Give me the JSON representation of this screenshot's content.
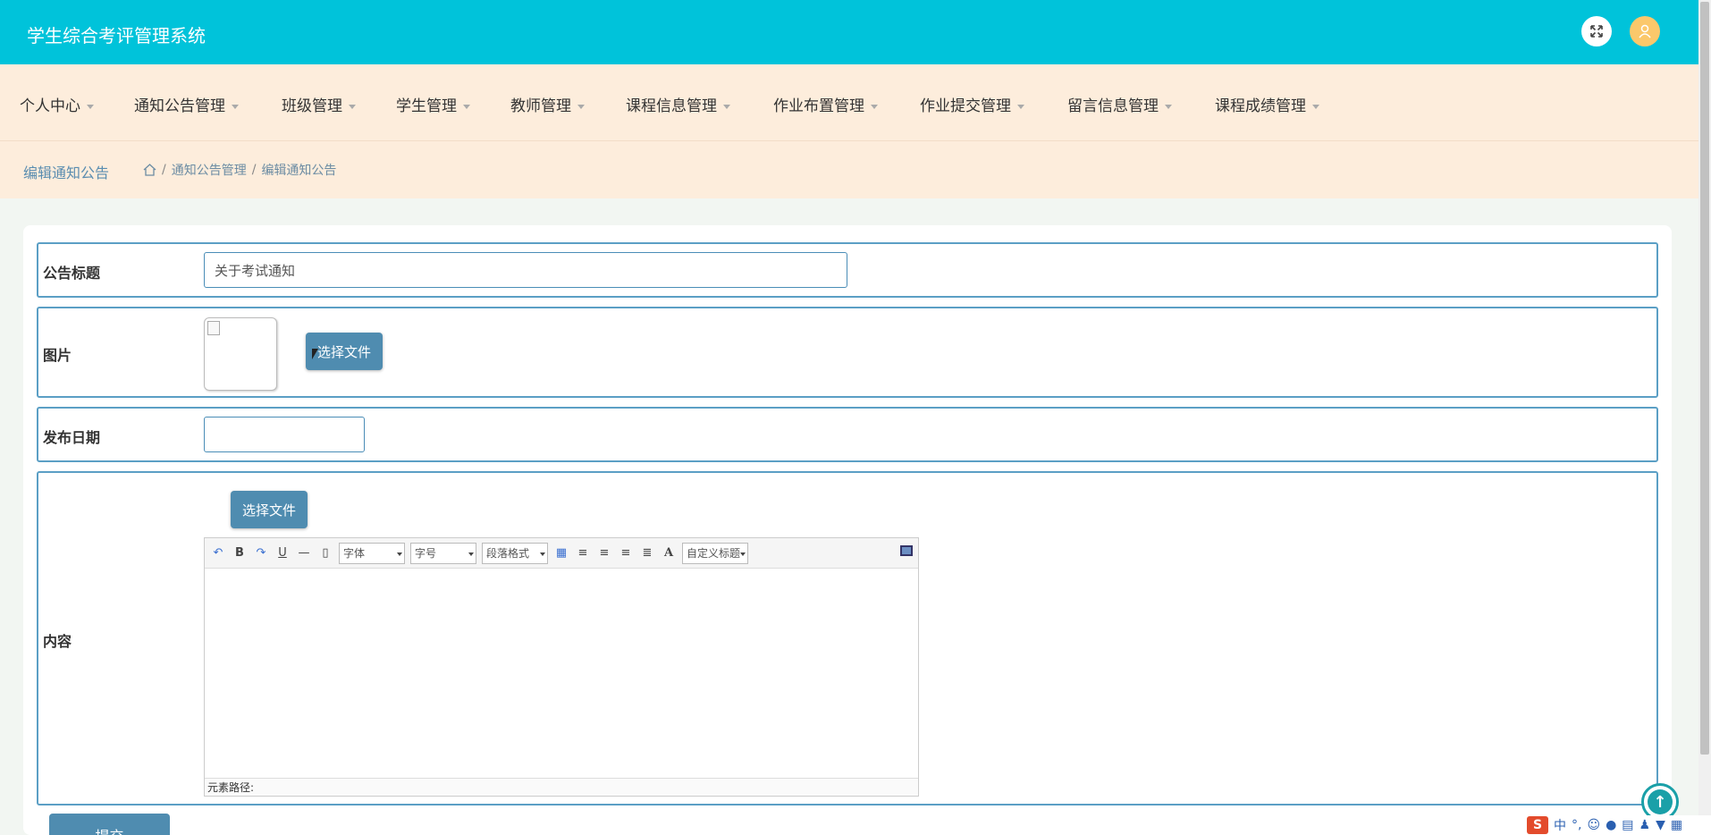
{
  "header": {
    "title": "学生综合考评管理系统",
    "fullscreen_icon": "expand-icon",
    "avatar_icon": "user-icon"
  },
  "nav": {
    "items": [
      {
        "label": "个人中心"
      },
      {
        "label": "通知公告管理"
      },
      {
        "label": "班级管理"
      },
      {
        "label": "学生管理"
      },
      {
        "label": "教师管理"
      },
      {
        "label": "课程信息管理"
      },
      {
        "label": "作业布置管理"
      },
      {
        "label": "作业提交管理"
      },
      {
        "label": "留言信息管理"
      },
      {
        "label": "课程成绩管理"
      }
    ]
  },
  "breadcrumb": {
    "title": "编辑通知公告",
    "home_icon": "home-icon",
    "separator": "/",
    "path": [
      "通知公告管理",
      "编辑通知公告"
    ]
  },
  "form": {
    "title_label": "公告标题",
    "title_value": "关于考试通知",
    "image_label": "图片",
    "choose_file": "选择文件",
    "date_label": "发布日期",
    "date_value": "",
    "content_label": "内容",
    "editor": {
      "font_family": "字体",
      "font_size": "字号",
      "paragraph": "段落格式",
      "custom_title": "自定义标题",
      "footer": "元素路径:"
    },
    "submit": "提交"
  },
  "ime": {
    "logo": "S",
    "mode": "中"
  },
  "colors": {
    "topbar": "#00c3da",
    "nav": "#fdeddc",
    "accent": "#4f8cb0",
    "border": "#5b9fc5"
  }
}
